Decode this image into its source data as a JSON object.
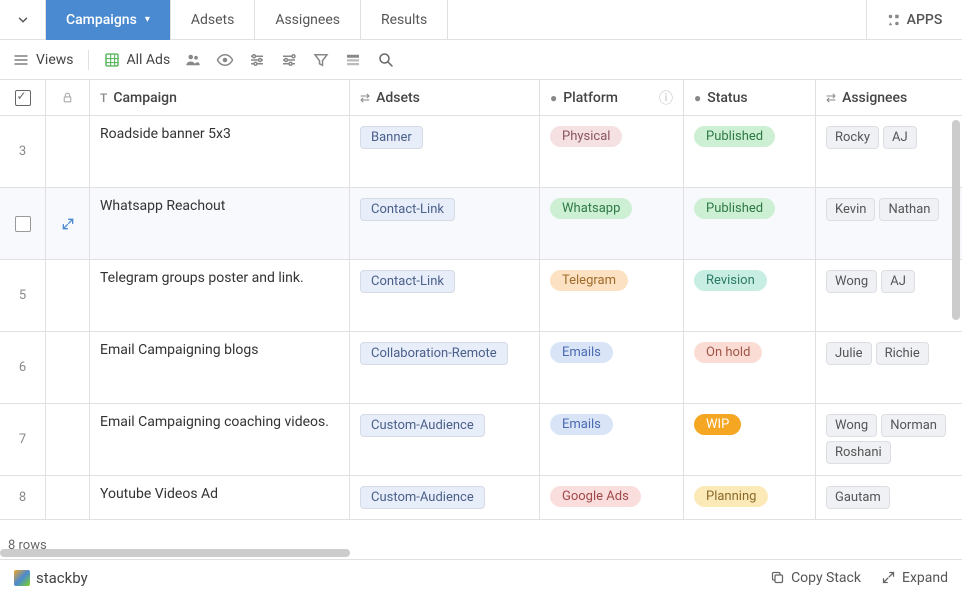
{
  "tabs": {
    "active": "Campaigns",
    "items": [
      "Campaigns",
      "Adsets",
      "Assignees",
      "Results"
    ],
    "apps": "APPS"
  },
  "toolbar": {
    "views": "Views",
    "all_ads": "All Ads"
  },
  "columns": {
    "campaign": "Campaign",
    "adsets": "Adsets",
    "platform": "Platform",
    "status": "Status",
    "assignees": "Assignees"
  },
  "rows": [
    {
      "n": "3",
      "campaign": "Roadside banner 5x3",
      "adsets": [
        "Banner"
      ],
      "platform": {
        "label": "Physical",
        "cls": "pill-pink"
      },
      "status": {
        "label": "Published",
        "cls": "pill-green"
      },
      "assignees": [
        "Rocky",
        "AJ"
      ],
      "hovered": false
    },
    {
      "n": "",
      "campaign": "Whatsapp Reachout",
      "adsets": [
        "Contact-Link"
      ],
      "platform": {
        "label": "Whatsapp",
        "cls": "pill-green"
      },
      "status": {
        "label": "Published",
        "cls": "pill-green"
      },
      "assignees": [
        "Kevin",
        "Nathan"
      ],
      "hovered": true
    },
    {
      "n": "5",
      "campaign": "Telegram groups poster and link.",
      "adsets": [
        "Contact-Link"
      ],
      "platform": {
        "label": "Telegram",
        "cls": "pill-orange"
      },
      "status": {
        "label": "Revision",
        "cls": "pill-teal"
      },
      "assignees": [
        "Wong",
        "AJ"
      ],
      "hovered": false
    },
    {
      "n": "6",
      "campaign": "Email Campaigning blogs",
      "adsets": [
        "Collaboration-Remote"
      ],
      "platform": {
        "label": "Emails",
        "cls": "pill-blue"
      },
      "status": {
        "label": "On hold",
        "cls": "pill-peach"
      },
      "assignees": [
        "Julie",
        "Richie"
      ],
      "hovered": false
    },
    {
      "n": "7",
      "campaign": "Email Campaigning coaching videos.",
      "adsets": [
        "Custom-Audience"
      ],
      "platform": {
        "label": "Emails",
        "cls": "pill-blue"
      },
      "status": {
        "label": "WIP",
        "cls": "pill-yellow-solid"
      },
      "assignees": [
        "Wong",
        "Norman",
        "Roshani"
      ],
      "hovered": false
    },
    {
      "n": "8",
      "campaign": "Youtube Videos Ad",
      "adsets": [
        "Custom-Audience"
      ],
      "platform": {
        "label": "Google Ads",
        "cls": "pill-red-lt"
      },
      "status": {
        "label": "Planning",
        "cls": "pill-yellow-lt"
      },
      "assignees": [
        "Gautam"
      ],
      "hovered": false,
      "short": true
    }
  ],
  "footer": {
    "rows_count": "8 rows",
    "brand": "stackby",
    "copy": "Copy Stack",
    "expand": "Expand"
  }
}
